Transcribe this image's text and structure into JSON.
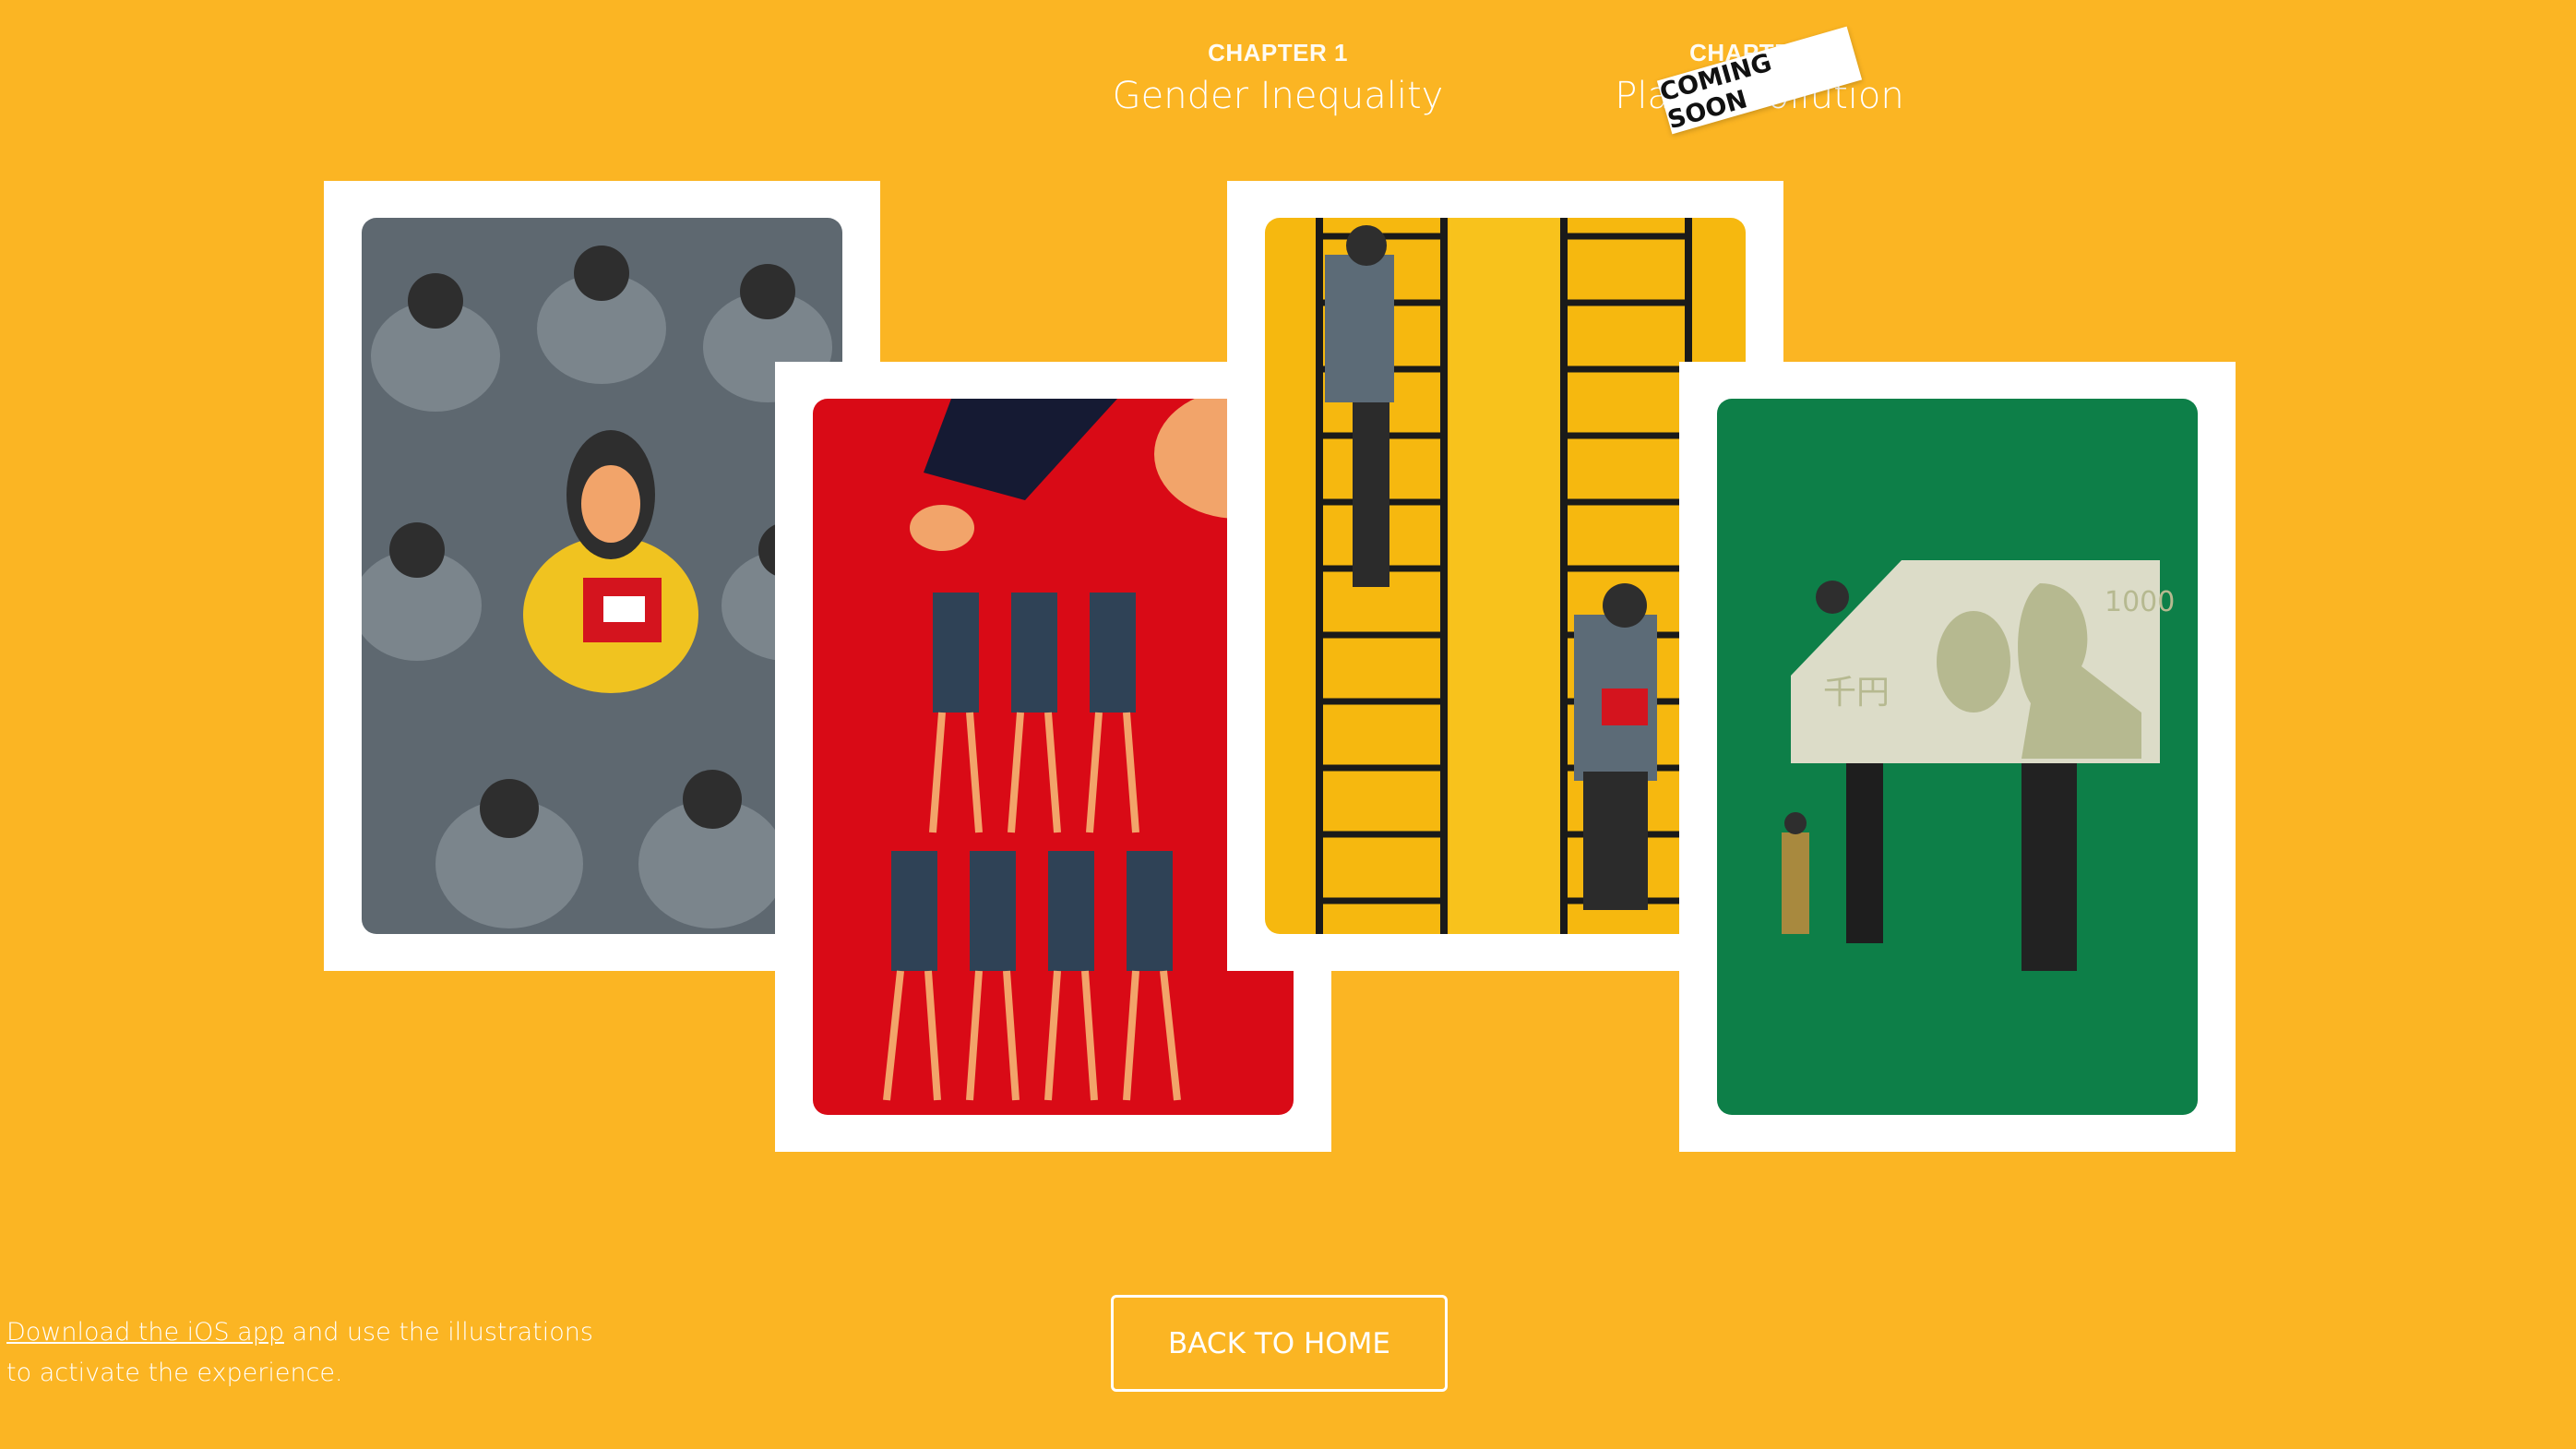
{
  "chapters": [
    {
      "label": "CHAPTER 1",
      "title": "Gender Inequality"
    },
    {
      "label": "CHAPTER 2",
      "title": "Plastic Pollution",
      "badge": "COMING SOON"
    }
  ],
  "cards": [
    {
      "illustration": "crowd-of-workers",
      "color": "#5e6870"
    },
    {
      "illustration": "human-pyramid",
      "color": "#d90a16"
    },
    {
      "illustration": "ladders",
      "color": "#f6b80f"
    },
    {
      "illustration": "family-with-banknote",
      "color": "#0d7f48",
      "banknote_value": "1000",
      "banknote_text": "千円"
    }
  ],
  "footer": {
    "link_text": "Download the iOS app",
    "text_1": " and use the illustrations",
    "text_2": "to activate the experience."
  },
  "back_button": "BACK TO HOME",
  "colors": {
    "background": "#fbb523",
    "text": "#ffffff"
  }
}
